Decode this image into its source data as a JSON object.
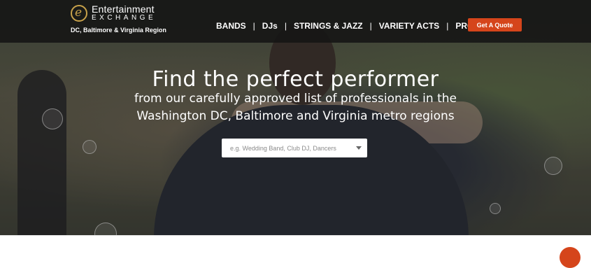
{
  "brand": {
    "name": "Entertainment",
    "subname": "EXCHANGE",
    "region": "DC, Baltimore & Virginia Region",
    "accent_color": "#c8a24a"
  },
  "nav": {
    "items": [
      "BANDS",
      "DJs",
      "STRINGS & JAZZ",
      "VARIETY ACTS",
      "PRODUCTION"
    ],
    "separator": "|"
  },
  "cta": {
    "label": "Get A Quote",
    "color": "#d5451b"
  },
  "hero": {
    "headline": "Find the perfect performer",
    "subline": "from our carefully approved list of professionals in the Washington DC, Baltimore and Virginia metro regions"
  },
  "search": {
    "placeholder": "e.g. Wedding Band, Club DJ, Dancers",
    "value": ""
  }
}
